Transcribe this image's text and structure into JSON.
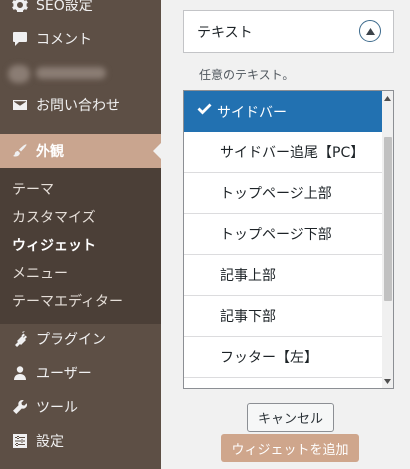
{
  "sidebar": {
    "top_items": [
      {
        "label": "SEO設定",
        "icon": "gear-icon"
      },
      {
        "label": "コメント",
        "icon": "comment-bubble-icon"
      }
    ],
    "mail_item": {
      "label": "お問い合わせ",
      "icon": "mail-icon"
    },
    "active_item": {
      "label": "外観",
      "icon": "paintbrush-icon"
    },
    "submenu": [
      "テーマ",
      "カスタマイズ",
      "ウィジェット",
      "メニュー",
      "テーマエディター"
    ],
    "current_submenu": "ウィジェット",
    "bottom_items": [
      {
        "label": "プラグイン",
        "icon": "plug-icon"
      },
      {
        "label": "ユーザー",
        "icon": "user-icon"
      },
      {
        "label": "ツール",
        "icon": "wrench-icon"
      },
      {
        "label": "設定",
        "icon": "settings-sliders-icon"
      }
    ]
  },
  "widget": {
    "title": "テキスト",
    "placeholder_label": "任意のテキスト。",
    "options": [
      "サイドバー",
      "サイドバー追尾【PC】",
      "トップページ上部",
      "トップページ下部",
      "記事上部",
      "記事下部",
      "フッター【左】"
    ],
    "selected_index": 0
  },
  "buttons": {
    "cancel": "キャンセル",
    "add": "ウィジェットを追加"
  },
  "colors": {
    "sidebar_bg": "#5d4f45",
    "submenu_bg": "#4b3f37",
    "active_bg": "#c9a58f",
    "selected_option": "#2271b1",
    "add_button": "#cfa68c"
  }
}
